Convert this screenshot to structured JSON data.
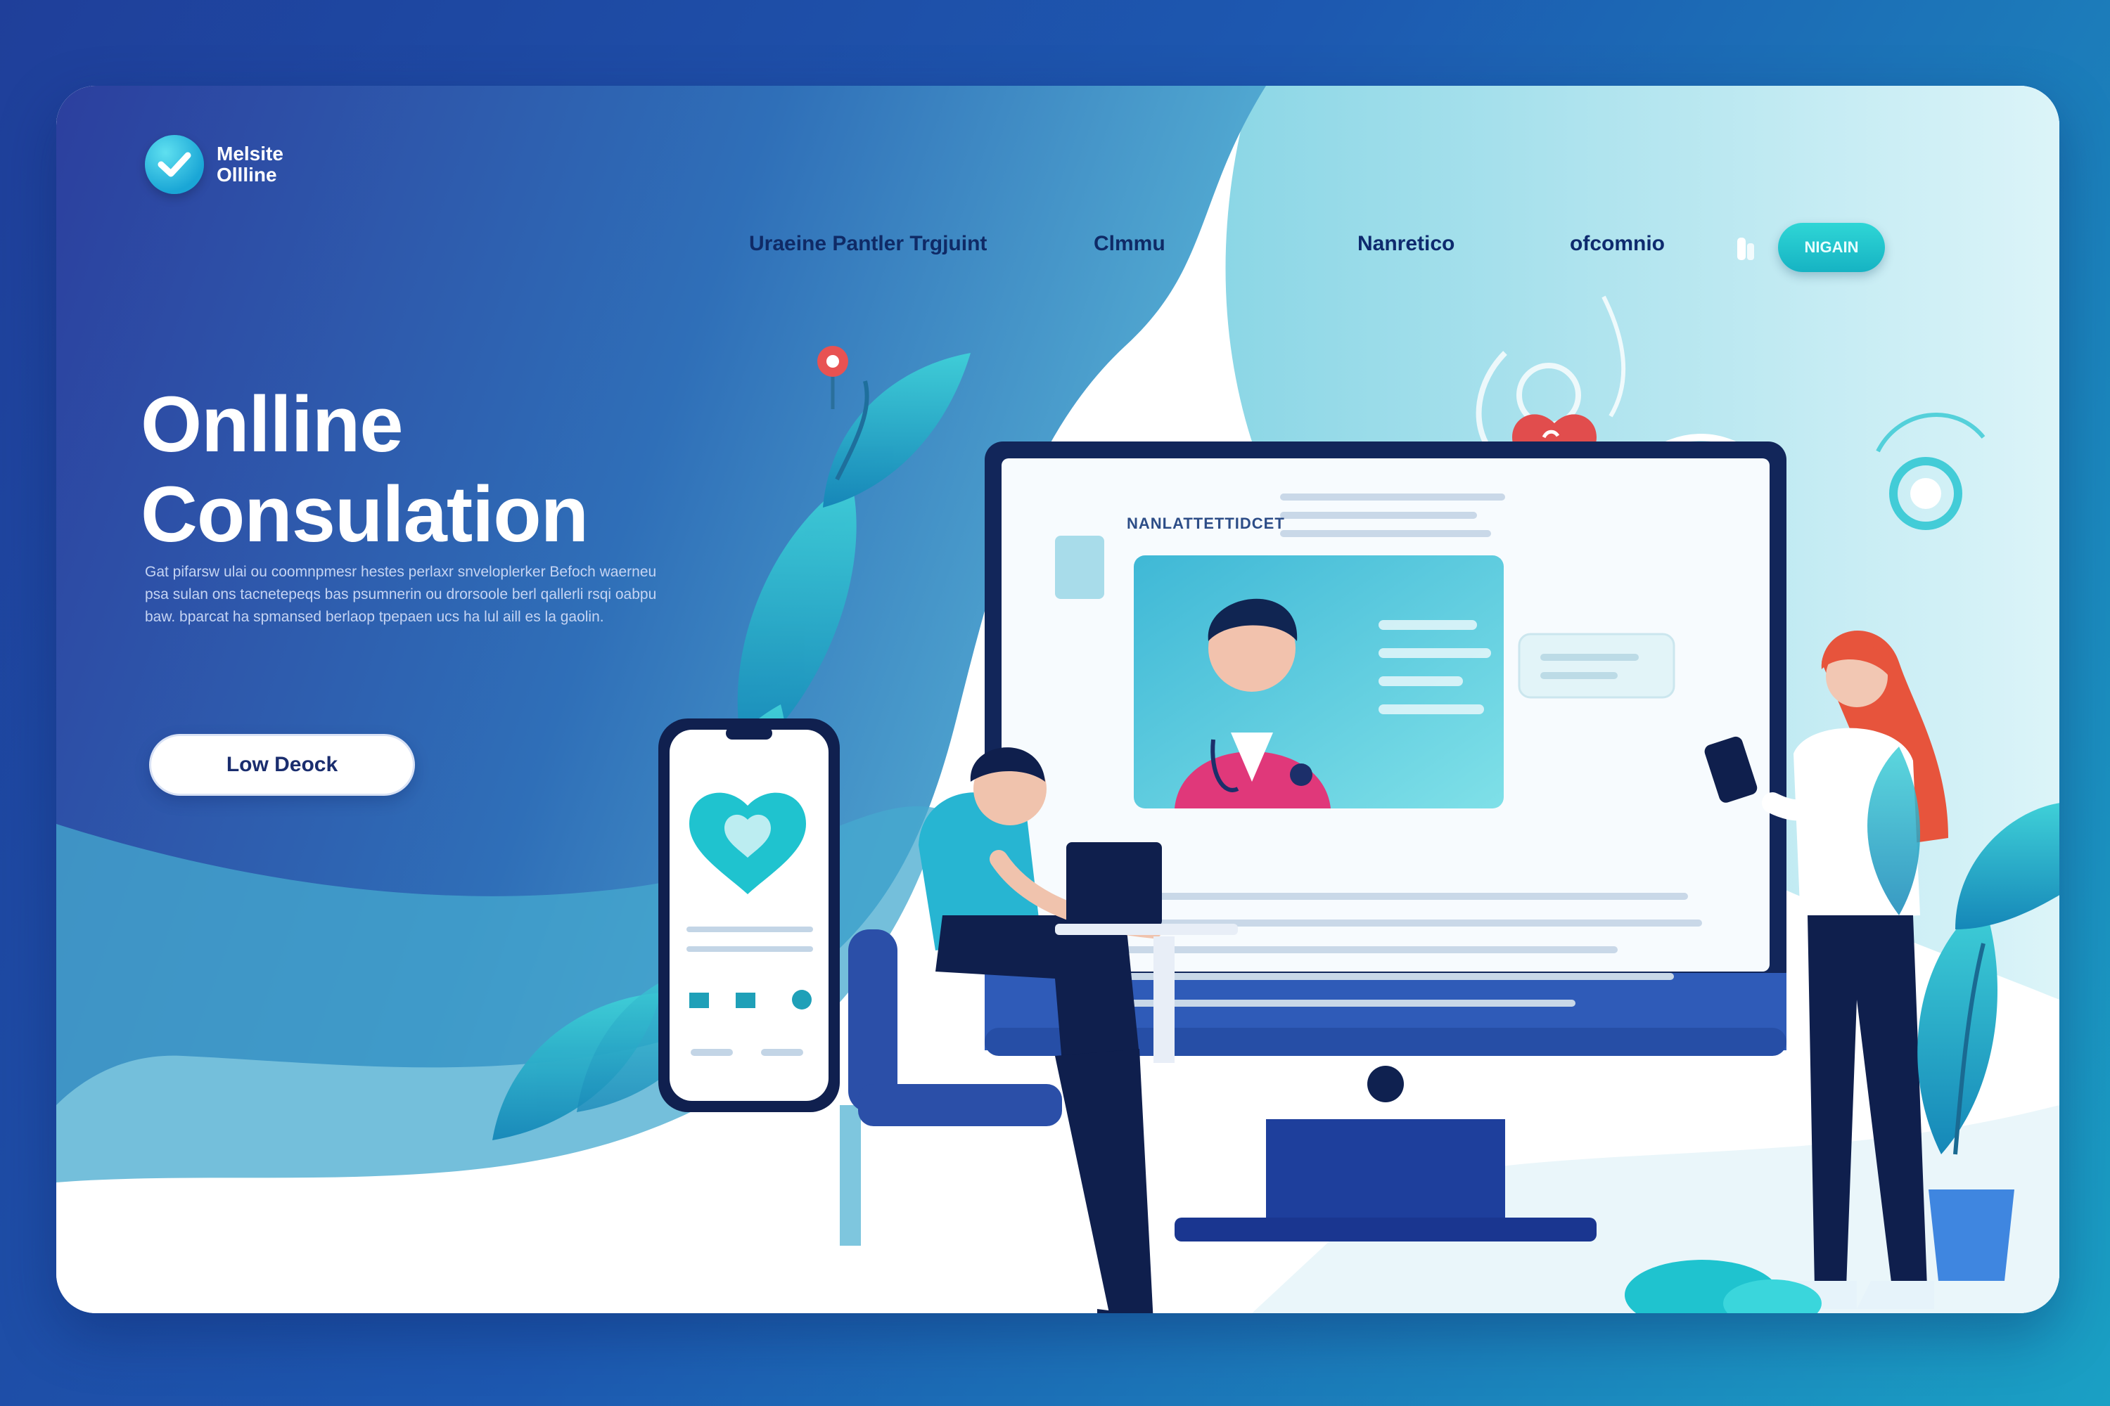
{
  "brand": {
    "line1": "Melsite",
    "line2": "Ollline"
  },
  "nav": {
    "items": [
      {
        "label": "Uraeine  Pantler  Trgjuint"
      },
      {
        "label": "Clmmu"
      },
      {
        "label": "Nanretico"
      },
      {
        "label": "ofcomnio"
      }
    ],
    "cta_label": "NIGAIN"
  },
  "hero": {
    "title_line1": "Onlline",
    "title_line2": "Consulation",
    "description": "Gat pifarsw ulai ou coomnpmesr hestes perlaxr snveloplerker Befoch waerneu psa sulan ons tacnetepeqs bas psumnerin ou drorsoole berl qallerli rsqi oabpu baw. bparcat ha spmansed berlaop tpepaen ucs ha lul aill es la gaolin.",
    "button_label": "Low Deock"
  },
  "monitor": {
    "heading": "NANLATTETTIDCET"
  },
  "colors": {
    "brand_blue": "#2a4fb0",
    "accent_teal": "#1fc3cf",
    "dark_navy": "#16285e",
    "heart_red": "#e04b4b"
  },
  "icons": [
    "check-icon",
    "heart-icon",
    "location-pin-icon",
    "user-icon",
    "stethoscope-icon"
  ]
}
